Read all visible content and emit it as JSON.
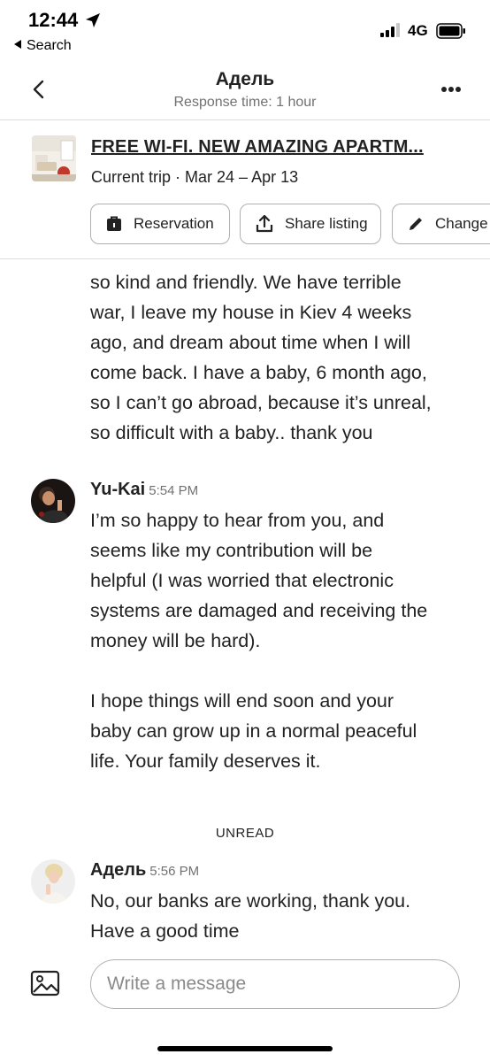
{
  "status_bar": {
    "time": "12:44",
    "back_app": "Search",
    "network": "4G"
  },
  "header": {
    "host_name": "Адель",
    "response_time": "Response time: 1 hour"
  },
  "listing": {
    "title": "FREE WI-FI. NEW AMAZING APARTM...",
    "trip": "Current trip · Mar 24 – Apr 13",
    "actions": [
      {
        "label": "Reservation",
        "icon": "briefcase-icon"
      },
      {
        "label": "Share listing",
        "icon": "share-icon"
      },
      {
        "label": "Change",
        "icon": "pencil-icon"
      }
    ]
  },
  "messages": [
    {
      "sender": "",
      "time": "",
      "lines": [
        "so kind and friendly. We have terrible",
        "war, I leave my house in Kiev 4 weeks",
        "ago, and dream about time when I will",
        "come back.  I have a baby, 6 month ago,",
        "so I can’t go abroad, because it’s unreal,",
        "so difficult with a baby.. thank you"
      ]
    },
    {
      "sender": "Yu-Kai",
      "time": "5:54 PM",
      "lines": [
        "I’m so happy to hear from you, and",
        "seems like my contribution will be",
        "helpful (I was worried that electronic",
        "systems are damaged and receiving the",
        "money will be hard).",
        "",
        "I hope things will end soon and your",
        "baby can grow up in a normal peaceful",
        "life. Your family deserves it."
      ]
    },
    {
      "sender": "Адель",
      "time": "5:56 PM",
      "lines": [
        "No, our banks are working, thank you.",
        "Have a good time"
      ]
    }
  ],
  "unread_label": "UNREAD",
  "composer": {
    "placeholder": "Write a message"
  },
  "colors": {
    "text": "#222222",
    "muted": "#717171",
    "border": "#b0b0b0",
    "divider": "#dddddd"
  }
}
